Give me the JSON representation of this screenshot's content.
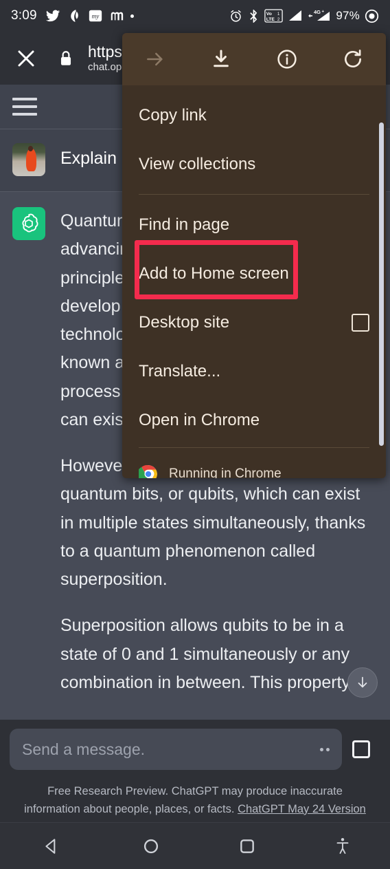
{
  "statusbar": {
    "time": "3:09",
    "left_icons": [
      "twitter-icon",
      "app-icon",
      "my-icon",
      "m-icon",
      "dot-icon"
    ],
    "right_icons": [
      "alarm-icon",
      "bluetooth-icon",
      "volte-icon",
      "signal-bar-1-icon",
      "signal-4g-icon"
    ],
    "battery_percent": "97%",
    "network_label": "4G+",
    "volte_label_top": "VoLTE",
    "volte_label_sim1": "1",
    "volte_label_sim2": "2"
  },
  "browser": {
    "close_icon": "close-icon",
    "lock_icon": "lock-icon",
    "url_line1": "https:/",
    "url_line2": "chat.ope"
  },
  "page": {
    "menu_icon": "hamburger-icon",
    "user_message": "Explain ",
    "avatar": "user-avatar-photo",
    "assistant_logo": "chatgpt-logo",
    "assistant_paragraphs": [
      "Quantum\nadvancin\nprinciple\ndevelop\ntechnolo\nknown a\nprocess\ncan exis",
      "However, quantum computers use quantum bits, or qubits, which can exist in multiple states simultaneously, thanks to a quantum phenomenon called superposition.",
      "Superposition allows qubits to be in a state of 0 and 1 simultaneously or any combination in between. This property"
    ],
    "scroll_down_icon": "arrow-down-icon"
  },
  "composer": {
    "placeholder": "Send a message.",
    "overflow_icon": "dots-icon",
    "stop_icon": "stop-square-icon"
  },
  "footer": {
    "line1": "Free Research Preview. ChatGPT may produce inaccurate",
    "line2": "information about people, places, or facts. ",
    "version_link": "ChatGPT May 24 Version"
  },
  "navbar": {
    "back": "back-triangle-icon",
    "home": "home-circle-icon",
    "recents": "recents-square-icon",
    "accessibility": "accessibility-icon"
  },
  "menu": {
    "toolbar": [
      {
        "name": "forward-icon",
        "disabled": true
      },
      {
        "name": "download-icon",
        "disabled": false
      },
      {
        "name": "page-info-icon",
        "disabled": false
      },
      {
        "name": "refresh-icon",
        "disabled": false
      }
    ],
    "items": [
      {
        "label": "Copy link",
        "type": "plain"
      },
      {
        "label": "View collections",
        "type": "plain"
      },
      {
        "separator": true
      },
      {
        "label": "Find in page",
        "type": "plain"
      },
      {
        "label": "Add to Home screen",
        "type": "plain",
        "highlighted": true
      },
      {
        "label": "Desktop site",
        "type": "checkbox",
        "checked": false
      },
      {
        "label": "Translate...",
        "type": "plain"
      },
      {
        "label": "Open in Chrome",
        "type": "plain"
      }
    ],
    "footer_label": "Running in Chrome",
    "footer_icon": "chrome-logo-icon",
    "highlight_color": "#f42b4d",
    "background_color": "#3e3125"
  }
}
